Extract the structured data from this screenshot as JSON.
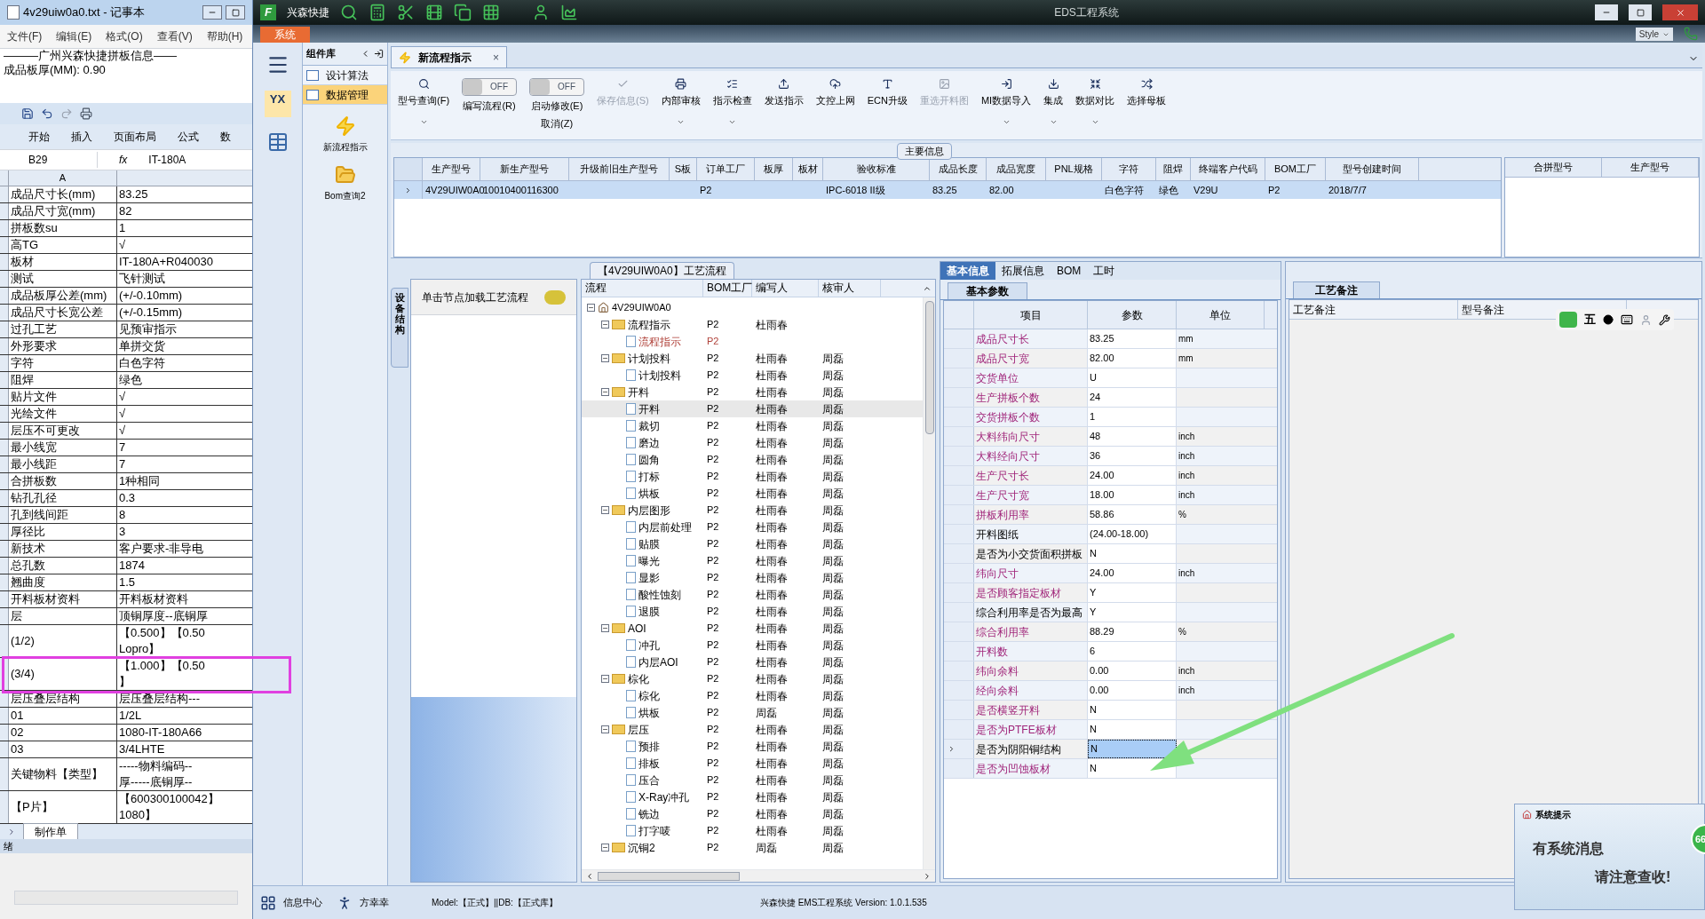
{
  "notepad": {
    "title": "4v29uiw0a0.txt - 记事本",
    "menu": [
      "文件(F)",
      "编辑(E)",
      "格式(O)",
      "查看(V)",
      "帮助(H)"
    ],
    "lines": [
      "———广州兴森快捷拼板信息——",
      "成品板厚(MM): 0.90"
    ]
  },
  "excel": {
    "ribbon_tabs": [
      "开始",
      "插入",
      "页面布局",
      "公式",
      "数"
    ],
    "name_box": "B29",
    "fx": "fx",
    "formula": "IT-180A",
    "column": "A",
    "sheet_tab": "制作单",
    "status": "绪",
    "rows": [
      {
        "a": "成品尺寸长(mm)",
        "b": [
          "83.25"
        ]
      },
      {
        "a": "成品尺寸宽(mm)",
        "b": [
          "82"
        ]
      },
      {
        "a": "拼板数su",
        "b": [
          "1"
        ]
      },
      {
        "a": "高TG",
        "b": [
          "√"
        ]
      },
      {
        "a": "板材",
        "b": [
          "IT-180A+R040030"
        ]
      },
      {
        "a": "测试",
        "b": [
          "飞针测试"
        ]
      },
      {
        "a": "成品板厚公差(mm)",
        "b": [
          "(+/-0.10mm)"
        ]
      },
      {
        "a": "成品尺寸长宽公差",
        "b": [
          "(+/-0.15mm)"
        ]
      },
      {
        "a": "过孔工艺",
        "b": [
          "见预审指示"
        ]
      },
      {
        "a": "外形要求",
        "b": [
          "单拼交货"
        ]
      },
      {
        "a": "字符",
        "b": [
          "白色字符"
        ]
      },
      {
        "a": "阻焊",
        "b": [
          "绿色"
        ]
      },
      {
        "a": "贴片文件",
        "b": [
          "√"
        ]
      },
      {
        "a": "光绘文件",
        "b": [
          "√"
        ]
      },
      {
        "a": "层压不可更改",
        "b": [
          "√"
        ]
      },
      {
        "a": "最小线宽",
        "b": [
          "7"
        ]
      },
      {
        "a": "最小线距",
        "b": [
          "7"
        ]
      },
      {
        "a": "合拼板数",
        "b": [
          "1种相同"
        ]
      },
      {
        "a": "钻孔孔径",
        "b": [
          "0.3"
        ]
      },
      {
        "a": "孔到线间距",
        "b": [
          "8"
        ]
      },
      {
        "a": "厚径比",
        "b": [
          "3"
        ]
      },
      {
        "a": "新技术",
        "b": [
          "客户要求-非导电"
        ]
      },
      {
        "a": "总孔数",
        "b": [
          "1874"
        ]
      },
      {
        "a": "翘曲度",
        "b": [
          "1.5"
        ]
      },
      {
        "a": "开料板材资料",
        "b": [
          "开料板材资料"
        ]
      },
      {
        "a": "层",
        "b": [
          "顶铜厚度--底铜厚"
        ]
      },
      {
        "a": "(1/2)",
        "b": [
          "【0.500】【0.50",
          "Lopro】"
        ]
      },
      {
        "a": "(3/4)",
        "b": [
          "【1.000】【0.50",
          "】"
        ]
      },
      {
        "a": "层压叠层结构",
        "b": [
          "层压叠层结构---"
        ]
      },
      {
        "a": "01",
        "b": [
          "1/2L"
        ]
      },
      {
        "a": "02",
        "b": [
          "1080-IT-180A66"
        ]
      },
      {
        "a": "03",
        "b": [
          "3/4LHTE"
        ]
      },
      {
        "a": "关键物料【类型】",
        "b": [
          "-----物料编码--",
          "厚-----底铜厚--"
        ]
      },
      {
        "a": "【P片】",
        "b": [
          "【600300100042】",
          "1080】"
        ]
      }
    ]
  },
  "app": {
    "logo": "F",
    "brand": "兴森快捷",
    "title": "EDS工程系统",
    "system_tab": "系统",
    "style": "Style",
    "rail_logo": "YX"
  },
  "component_panel": {
    "title": "组件库",
    "items": [
      {
        "label": "设计算法",
        "selected": false
      },
      {
        "label": "数据管理",
        "selected": true
      }
    ],
    "tools": [
      "新流程指示",
      "Bom查询2"
    ]
  },
  "doc_tab": {
    "label": "新流程指示",
    "close": "×"
  },
  "toolbar": [
    {
      "kind": "button",
      "label": "型号查询(F)",
      "disabled": false,
      "dropdown": true
    },
    {
      "kind": "toggle",
      "label": "编写流程(R)",
      "toggle_text": "OFF",
      "on": false
    },
    {
      "kind": "toggle",
      "label": "启动修改(E)",
      "sublabel": "取消(Z)",
      "toggle_text": "OFF",
      "on": false
    },
    {
      "kind": "button",
      "label": "保存信息(S)",
      "disabled": true,
      "dropdown": false
    },
    {
      "kind": "button",
      "label": "内部审核",
      "disabled": false,
      "dropdown": true
    },
    {
      "kind": "button",
      "label": "指示检查",
      "disabled": false,
      "dropdown": true
    },
    {
      "kind": "button",
      "label": "发送指示",
      "disabled": false,
      "dropdown": false
    },
    {
      "kind": "button",
      "label": "文控上网",
      "disabled": false,
      "dropdown": false
    },
    {
      "kind": "button",
      "label": "ECN升级",
      "disabled": false,
      "dropdown": false
    },
    {
      "kind": "button",
      "label": "重选开料图",
      "disabled": true,
      "dropdown": false
    },
    {
      "kind": "button",
      "label": "MI数据导入",
      "disabled": false,
      "dropdown": true
    },
    {
      "kind": "button",
      "label": "集成",
      "disabled": false,
      "dropdown": true
    },
    {
      "kind": "button",
      "label": "数据对比",
      "disabled": false,
      "dropdown": true
    },
    {
      "kind": "button",
      "label": "选择母板",
      "disabled": false,
      "dropdown": false
    }
  ],
  "main_info": {
    "title": "主要信息",
    "columns": [
      "生产型号",
      "新生产型号",
      "升级前旧生产型号",
      "S板",
      "订单工厂",
      "板厚",
      "板材",
      "验收标准",
      "成品长度",
      "成品宽度",
      "PNL规格",
      "字符",
      "阻焊",
      "终端客户代码",
      "BOM工厂",
      "型号创建时间"
    ],
    "rows": [
      {
        "selected": true,
        "cells": [
          "4V29UIW0A0",
          "10010400116300",
          null,
          null,
          "P2",
          null,
          null,
          "IPC-6018 II级",
          "83.25",
          "82.00",
          null,
          "白色字符",
          "绿色",
          "V29U",
          "P2",
          "2018/7/7"
        ]
      }
    ],
    "side_columns": [
      "合拼型号",
      "生产型号"
    ]
  },
  "device_panel": {
    "vertical_tab": "设备结构",
    "hint": "单击节点加载工艺流程"
  },
  "process": {
    "title": "【4V29UIW0A0】工艺流程",
    "columns": [
      "流程",
      "BOM工厂",
      "编写人",
      "核审人"
    ],
    "root": {
      "label": "4V29UIW0A0",
      "expanded": true,
      "selected": false,
      "pending": false,
      "children": [
        {
          "label": "流程指示",
          "bom": "P2",
          "writer": "杜雨春",
          "expanded": true,
          "selected": false,
          "pending": false,
          "children": [
            {
              "label": "流程指示",
              "bom": "P2",
              "selected": false,
              "pending": true
            }
          ]
        },
        {
          "label": "计划投料",
          "bom": "P2",
          "writer": "杜雨春",
          "reviewer": "周磊",
          "expanded": true,
          "selected": false,
          "pending": false,
          "children": [
            {
              "label": "计划投料",
              "bom": "P2",
              "writer": "杜雨春",
              "reviewer": "周磊",
              "selected": false,
              "pending": false
            }
          ]
        },
        {
          "label": "开料",
          "bom": "P2",
          "writer": "杜雨春",
          "reviewer": "周磊",
          "expanded": true,
          "selected": false,
          "pending": false,
          "children": [
            {
              "label": "开料",
              "bom": "P2",
              "writer": "杜雨春",
              "reviewer": "周磊",
              "selected": true,
              "pending": false
            },
            {
              "label": "裁切",
              "bom": "P2",
              "writer": "杜雨春",
              "reviewer": "周磊",
              "selected": false,
              "pending": false
            },
            {
              "label": "磨边",
              "bom": "P2",
              "writer": "杜雨春",
              "reviewer": "周磊",
              "selected": false,
              "pending": false
            },
            {
              "label": "圆角",
              "bom": "P2",
              "writer": "杜雨春",
              "reviewer": "周磊",
              "selected": false,
              "pending": false
            },
            {
              "label": "打标",
              "bom": "P2",
              "writer": "杜雨春",
              "reviewer": "周磊",
              "selected": false,
              "pending": false
            },
            {
              "label": "烘板",
              "bom": "P2",
              "writer": "杜雨春",
              "reviewer": "周磊",
              "selected": false,
              "pending": false
            }
          ]
        },
        {
          "label": "内层图形",
          "bom": "P2",
          "writer": "杜雨春",
          "reviewer": "周磊",
          "expanded": true,
          "selected": false,
          "pending": false,
          "children": [
            {
              "label": "内层前处理",
              "bom": "P2",
              "writer": "杜雨春",
              "reviewer": "周磊",
              "selected": false,
              "pending": false
            },
            {
              "label": "贴膜",
              "bom": "P2",
              "writer": "杜雨春",
              "reviewer": "周磊",
              "selected": false,
              "pending": false
            },
            {
              "label": "曝光",
              "bom": "P2",
              "writer": "杜雨春",
              "reviewer": "周磊",
              "selected": false,
              "pending": false
            },
            {
              "label": "显影",
              "bom": "P2",
              "writer": "杜雨春",
              "reviewer": "周磊",
              "selected": false,
              "pending": false
            },
            {
              "label": "酸性蚀刻",
              "bom": "P2",
              "writer": "杜雨春",
              "reviewer": "周磊",
              "selected": false,
              "pending": false
            },
            {
              "label": "退膜",
              "bom": "P2",
              "writer": "杜雨春",
              "reviewer": "周磊",
              "selected": false,
              "pending": false
            }
          ]
        },
        {
          "label": "AOI",
          "bom": "P2",
          "writer": "杜雨春",
          "reviewer": "周磊",
          "expanded": true,
          "selected": false,
          "pending": false,
          "children": [
            {
              "label": "冲孔",
              "bom": "P2",
              "writer": "杜雨春",
              "reviewer": "周磊",
              "selected": false,
              "pending": false
            },
            {
              "label": "内层AOI",
              "bom": "P2",
              "writer": "杜雨春",
              "reviewer": "周磊",
              "selected": false,
              "pending": false
            }
          ]
        },
        {
          "label": "棕化",
          "bom": "P2",
          "writer": "杜雨春",
          "reviewer": "周磊",
          "expanded": true,
          "selected": false,
          "pending": false,
          "children": [
            {
              "label": "棕化",
              "bom": "P2",
              "writer": "杜雨春",
              "reviewer": "周磊",
              "selected": false,
              "pending": false
            },
            {
              "label": "烘板",
              "bom": "P2",
              "writer": "周磊",
              "reviewer": "周磊",
              "selected": false,
              "pending": false
            }
          ]
        },
        {
          "label": "层压",
          "bom": "P2",
          "writer": "杜雨春",
          "reviewer": "周磊",
          "expanded": true,
          "selected": false,
          "pending": false,
          "children": [
            {
              "label": "预排",
              "bom": "P2",
              "writer": "杜雨春",
              "reviewer": "周磊",
              "selected": false,
              "pending": false
            },
            {
              "label": "排板",
              "bom": "P2",
              "writer": "杜雨春",
              "reviewer": "周磊",
              "selected": false,
              "pending": false
            },
            {
              "label": "压合",
              "bom": "P2",
              "writer": "杜雨春",
              "reviewer": "周磊",
              "selected": false,
              "pending": false
            },
            {
              "label": "X-Ray冲孔",
              "bom": "P2",
              "writer": "杜雨春",
              "reviewer": "周磊",
              "selected": false,
              "pending": false
            },
            {
              "label": "铣边",
              "bom": "P2",
              "writer": "杜雨春",
              "reviewer": "周磊",
              "selected": false,
              "pending": false
            },
            {
              "label": "打字唛",
              "bom": "P2",
              "writer": "杜雨春",
              "reviewer": "周磊",
              "selected": false,
              "pending": false
            }
          ]
        },
        {
          "label": "沉铜2",
          "bom": "P2",
          "writer": "周磊",
          "reviewer": "周磊",
          "expanded": true,
          "selected": false,
          "pending": false
        }
      ]
    }
  },
  "info_tabs": [
    {
      "label": "基本信息",
      "selected": true
    },
    {
      "label": "拓展信息",
      "selected": false
    },
    {
      "label": "BOM",
      "selected": false
    },
    {
      "label": "工时",
      "selected": false
    }
  ],
  "basic_params": {
    "tab": "基本参数",
    "columns": [
      "项目",
      "参数",
      "单位"
    ],
    "rows": [
      {
        "item": "成品尺寸长",
        "value": "83.25",
        "unit": "mm",
        "required": true,
        "selected": false
      },
      {
        "item": "成品尺寸宽",
        "value": "82.00",
        "unit": "mm",
        "required": true,
        "selected": false
      },
      {
        "item": "交货单位",
        "value": "U",
        "required": true,
        "selected": false
      },
      {
        "item": "生产拼板个数",
        "value": "24",
        "required": true,
        "selected": false
      },
      {
        "item": "交货拼板个数",
        "value": "1",
        "required": true,
        "selected": false
      },
      {
        "item": "大料纬向尺寸",
        "value": "48",
        "unit": "inch",
        "required": true,
        "selected": false
      },
      {
        "item": "大料经向尺寸",
        "value": "36",
        "unit": "inch",
        "required": true,
        "selected": false
      },
      {
        "item": "生产尺寸长",
        "value": "24.00",
        "unit": "inch",
        "required": true,
        "selected": false
      },
      {
        "item": "生产尺寸宽",
        "value": "18.00",
        "unit": "inch",
        "required": true,
        "selected": false
      },
      {
        "item": "拼板利用率",
        "value": "58.86",
        "unit": "%",
        "required": true,
        "selected": false
      },
      {
        "item": "开料图纸",
        "value": "(24.00-18.00)",
        "required": false,
        "selected": false
      },
      {
        "item": "是否为小交货面积拼板",
        "value": "N",
        "required": false,
        "selected": false
      },
      {
        "item": "纬向尺寸",
        "value": "24.00",
        "unit": "inch",
        "required": true,
        "selected": false
      },
      {
        "item": "是否顾客指定板材",
        "value": "Y",
        "required": true,
        "selected": false
      },
      {
        "item": "综合利用率是否为最高",
        "value": "Y",
        "required": false,
        "selected": false
      },
      {
        "item": "综合利用率",
        "value": "88.29",
        "unit": "%",
        "required": true,
        "selected": false
      },
      {
        "item": "开料数",
        "value": "6",
        "required": true,
        "selected": false
      },
      {
        "item": "纬向余料",
        "value": "0.00",
        "unit": "inch",
        "required": true,
        "selected": false
      },
      {
        "item": "经向余料",
        "value": "0.00",
        "unit": "inch",
        "required": true,
        "selected": false
      },
      {
        "item": "是否横竖开料",
        "value": "N",
        "required": true,
        "selected": false
      },
      {
        "item": "是否为PTFE板材",
        "value": "N",
        "required": true,
        "selected": false
      },
      {
        "item": "是否为阴阳铜结构",
        "value": "N",
        "required": false,
        "selected": true
      },
      {
        "item": "是否为凹蚀板材",
        "value": "N",
        "required": true,
        "selected": false
      }
    ]
  },
  "notes": {
    "tab": "工艺备注",
    "columns": [
      "工艺备注",
      "型号备注"
    ]
  },
  "ime": {
    "mode": "五"
  },
  "status_bar": {
    "info_center": "信息中心",
    "user": "方幸幸",
    "model": "Model:【正式】||DB:【正式库】",
    "version": "兴森快捷 EMS工程系统 Version: 1.0.1.535"
  },
  "popup": {
    "title": "系统提示",
    "line1": "有系统消息",
    "line2": "请注意查收!",
    "badge": "66"
  }
}
